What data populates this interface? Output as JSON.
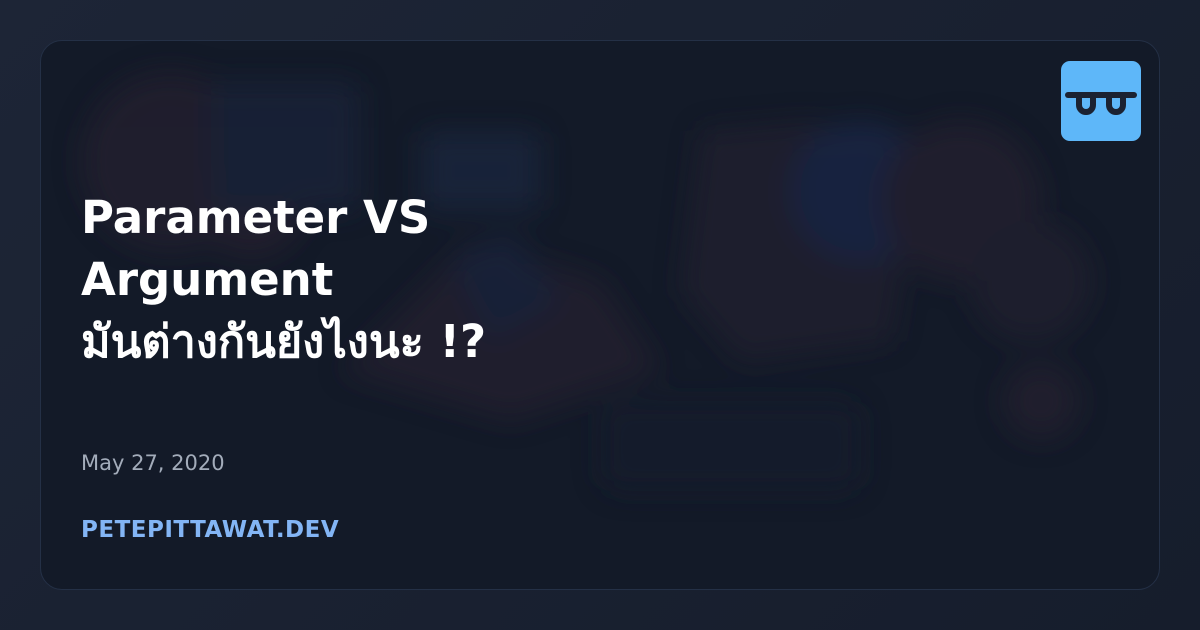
{
  "post": {
    "title_lines": [
      "Parameter VS",
      "Argument",
      "มันต่างกันยังไงนะ !?"
    ],
    "date": "May 27, 2020"
  },
  "site": {
    "name": "PETEPITTAWAT.DEV",
    "logo_icon": "rounded-glasses-logo-icon",
    "accent_color": "#5eb7f9"
  }
}
